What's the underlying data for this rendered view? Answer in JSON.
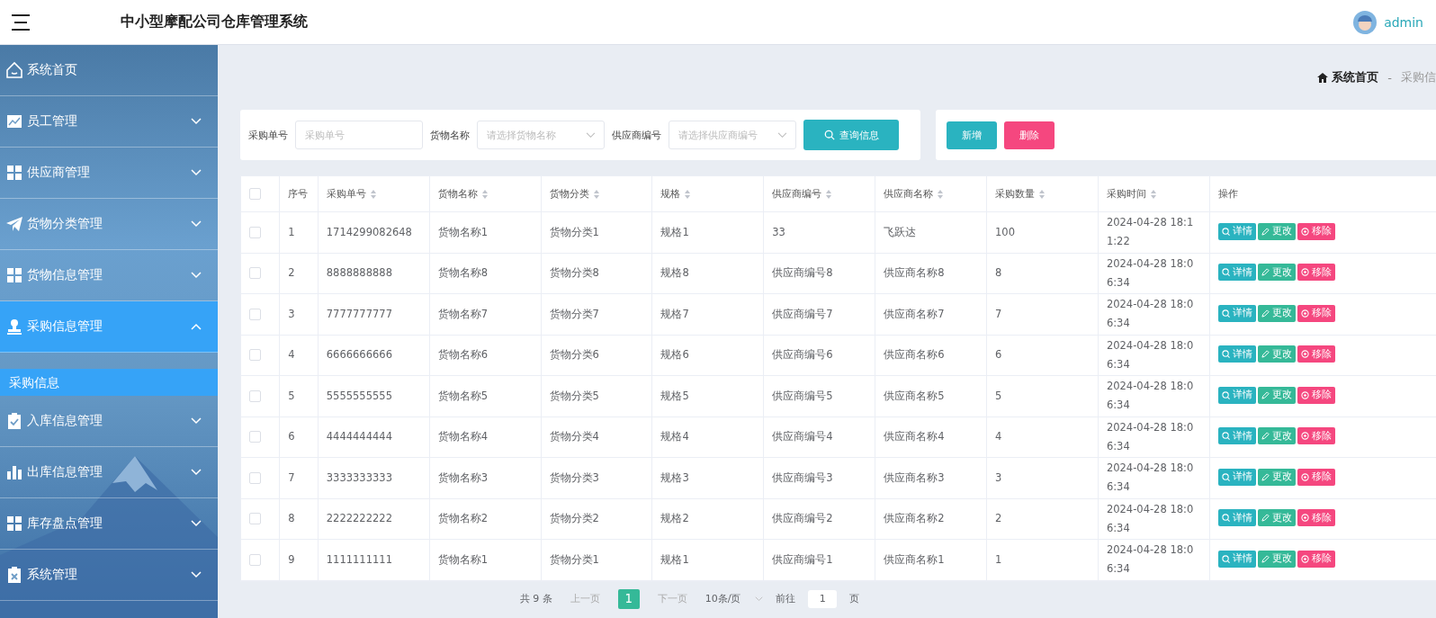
{
  "header": {
    "title": "中小型摩配公司仓库管理系统",
    "user": "admin"
  },
  "sidebar": {
    "items": [
      {
        "label": "系统首页",
        "selected": false
      },
      {
        "label": "员工管理",
        "expanded": false,
        "selected": false
      },
      {
        "label": "供应商管理",
        "expanded": false,
        "selected": false
      },
      {
        "label": "货物分类管理",
        "expanded": false,
        "selected": false
      },
      {
        "label": "货物信息管理",
        "expanded": false,
        "selected": false
      },
      {
        "label": "采购信息管理",
        "expanded": true,
        "selected": true,
        "children": [
          {
            "label": "采购信息",
            "selected": true
          }
        ]
      },
      {
        "label": "入库信息管理",
        "expanded": false,
        "selected": false
      },
      {
        "label": "出库信息管理",
        "expanded": false,
        "selected": false
      },
      {
        "label": "库存盘点管理",
        "expanded": false,
        "selected": false
      },
      {
        "label": "系统管理",
        "expanded": false,
        "selected": false
      }
    ]
  },
  "breadcrumb": {
    "home": "系统首页",
    "separator": "-",
    "current": "采购信"
  },
  "search": {
    "fields": [
      {
        "label": "采购单号",
        "placeholder": "采购单号",
        "kind": "input"
      },
      {
        "label": "货物名称",
        "placeholder": "请选择货物名称",
        "kind": "select"
      },
      {
        "label": "供应商编号",
        "placeholder": "请选择供应商编号",
        "kind": "select"
      }
    ],
    "button": "查询信息"
  },
  "actions": {
    "add": "新增",
    "delete": "删除"
  },
  "table": {
    "columns": [
      "序号",
      "采购单号",
      "货物名称",
      "货物分类",
      "规格",
      "供应商编号",
      "供应商名称",
      "采购数量",
      "采购时间",
      "操作"
    ],
    "select_all_checked": false,
    "rows": [
      {
        "checked": false,
        "cells": [
          "1",
          "1714299082648",
          "货物名称1",
          "货物分类1",
          "规格1",
          "33",
          "飞跃达",
          "100",
          "2024-04-28 18:11:22"
        ],
        "buttons": [
          "详情",
          "更改",
          "移除"
        ]
      },
      {
        "checked": false,
        "cells": [
          "2",
          "8888888888",
          "货物名称8",
          "货物分类8",
          "规格8",
          "供应商编号8",
          "供应商名称8",
          "8",
          "2024-04-28 18:06:34"
        ],
        "buttons": [
          "详情",
          "更改",
          "移除"
        ]
      },
      {
        "checked": false,
        "cells": [
          "3",
          "7777777777",
          "货物名称7",
          "货物分类7",
          "规格7",
          "供应商编号7",
          "供应商名称7",
          "7",
          "2024-04-28 18:06:34"
        ],
        "buttons": [
          "详情",
          "更改",
          "移除"
        ]
      },
      {
        "checked": false,
        "cells": [
          "4",
          "6666666666",
          "货物名称6",
          "货物分类6",
          "规格6",
          "供应商编号6",
          "供应商名称6",
          "6",
          "2024-04-28 18:06:34"
        ],
        "buttons": [
          "详情",
          "更改",
          "移除"
        ]
      },
      {
        "checked": false,
        "cells": [
          "5",
          "5555555555",
          "货物名称5",
          "货物分类5",
          "规格5",
          "供应商编号5",
          "供应商名称5",
          "5",
          "2024-04-28 18:06:34"
        ],
        "buttons": [
          "详情",
          "更改",
          "移除"
        ]
      },
      {
        "checked": false,
        "cells": [
          "6",
          "4444444444",
          "货物名称4",
          "货物分类4",
          "规格4",
          "供应商编号4",
          "供应商名称4",
          "4",
          "2024-04-28 18:06:34"
        ],
        "buttons": [
          "详情",
          "更改",
          "移除"
        ]
      },
      {
        "checked": false,
        "cells": [
          "7",
          "3333333333",
          "货物名称3",
          "货物分类3",
          "规格3",
          "供应商编号3",
          "供应商名称3",
          "3",
          "2024-04-28 18:06:34"
        ],
        "buttons": [
          "详情",
          "更改",
          "移除"
        ]
      },
      {
        "checked": false,
        "cells": [
          "8",
          "2222222222",
          "货物名称2",
          "货物分类2",
          "规格2",
          "供应商编号2",
          "供应商名称2",
          "2",
          "2024-04-28 18:06:34"
        ],
        "buttons": [
          "详情",
          "更改",
          "移除"
        ]
      },
      {
        "checked": false,
        "cells": [
          "9",
          "1111111111",
          "货物名称1",
          "货物分类1",
          "规格1",
          "供应商编号1",
          "供应商名称1",
          "1",
          "2024-04-28 18:06:34"
        ],
        "buttons": [
          "详情",
          "更改",
          "移除"
        ]
      }
    ]
  },
  "pagination": {
    "total": "共 9 条",
    "prev": "上一页",
    "pages": [
      {
        "label": "1",
        "selected": true
      }
    ],
    "next": "下一页",
    "page_size": "10条/页",
    "goto": "前往",
    "goto_value": "1",
    "page_unit": "页"
  }
}
